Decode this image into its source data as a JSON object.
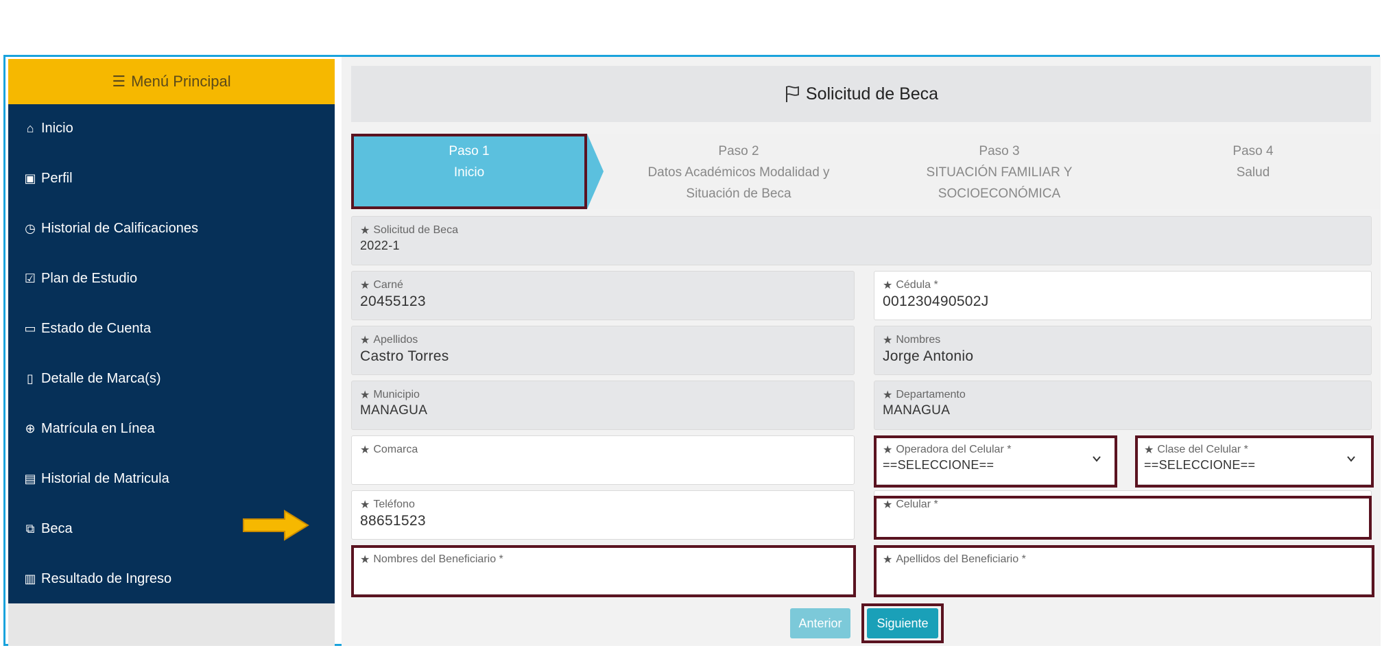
{
  "sidebar": {
    "header": "Menú Principal",
    "items": [
      {
        "label": "Inicio",
        "icon": "home-icon"
      },
      {
        "label": "Perfil",
        "icon": "user-card-icon"
      },
      {
        "label": "Historial de Calificaciones",
        "icon": "clock-icon"
      },
      {
        "label": "Plan de Estudio",
        "icon": "checklist-icon"
      },
      {
        "label": "Estado de Cuenta",
        "icon": "folder-icon"
      },
      {
        "label": "Detalle de Marca(s)",
        "icon": "document-icon"
      },
      {
        "label": "Matrícula en Línea",
        "icon": "globe-icon"
      },
      {
        "label": "Historial de Matricula",
        "icon": "list-icon"
      },
      {
        "label": "Beca",
        "icon": "scholarship-icon"
      },
      {
        "label": "Resultado de Ingreso",
        "icon": "id-card-icon"
      }
    ]
  },
  "page": {
    "title": "Solicitud de Beca"
  },
  "wizard": {
    "steps": [
      {
        "num": "Paso 1",
        "line1": "Inicio",
        "line2": ""
      },
      {
        "num": "Paso 2",
        "line1": "Datos Académicos Modalidad y",
        "line2": "Situación de Beca"
      },
      {
        "num": "Paso 3",
        "line1": "SITUACIÓN FAMILIAR Y",
        "line2": "SOCIOECONÓMICA"
      },
      {
        "num": "Paso 4",
        "line1": "Salud",
        "line2": ""
      }
    ]
  },
  "form": {
    "solicitud": {
      "label": "Solicitud de Beca",
      "value": "2022-1"
    },
    "carne": {
      "label": "Carné",
      "value": "20455123"
    },
    "cedula": {
      "label": "Cédula *",
      "value": "001230490502J"
    },
    "apellidos": {
      "label": "Apellidos",
      "value": "Castro Torres"
    },
    "nombres": {
      "label": "Nombres",
      "value": "Jorge Antonio"
    },
    "municipio": {
      "label": "Municipio",
      "value": "MANAGUA"
    },
    "departamento": {
      "label": "Departamento",
      "value": "MANAGUA"
    },
    "comarca": {
      "label": "Comarca",
      "value": ""
    },
    "operadora": {
      "label": "Operadora del Celular *",
      "value": "==SELECCIONE=="
    },
    "clase": {
      "label": "Clase del Celular *",
      "value": "==SELECCIONE=="
    },
    "telefono": {
      "label": "Teléfono",
      "value": "88651523"
    },
    "celular": {
      "label": "Celular *",
      "value": ""
    },
    "nombres_beneficiario": {
      "label": "Nombres del Beneficiario *",
      "value": ""
    },
    "apellidos_beneficiario": {
      "label": "Apellidos del Beneficiario *",
      "value": ""
    }
  },
  "buttons": {
    "prev": "Anterior",
    "next": "Siguiente"
  },
  "colors": {
    "sidebar_bg": "#063058",
    "sidebar_header": "#f6b800",
    "active_step": "#5bc0de",
    "highlight_border": "#5a1320",
    "arrow": "#f6b800",
    "frame_border": "#1aa3dc"
  }
}
